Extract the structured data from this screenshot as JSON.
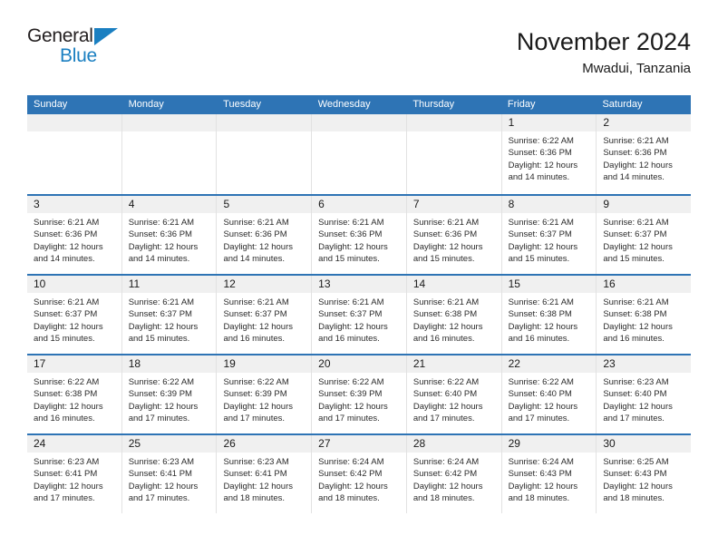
{
  "brand": {
    "name_top": "General",
    "name_bottom": "Blue",
    "accent_color": "#1a7fc1"
  },
  "header": {
    "title": "November 2024",
    "subtitle": "Mwadui, Tanzania",
    "header_bg_color": "#2e74b5",
    "number_strip_color": "#f0f0f0"
  },
  "weekdays": [
    "Sunday",
    "Monday",
    "Tuesday",
    "Wednesday",
    "Thursday",
    "Friday",
    "Saturday"
  ],
  "weeks": [
    [
      {
        "day": "",
        "empty": true
      },
      {
        "day": "",
        "empty": true
      },
      {
        "day": "",
        "empty": true
      },
      {
        "day": "",
        "empty": true
      },
      {
        "day": "",
        "empty": true
      },
      {
        "day": "1",
        "sunrise": "Sunrise: 6:22 AM",
        "sunset": "Sunset: 6:36 PM",
        "daylight1": "Daylight: 12 hours",
        "daylight2": "and 14 minutes."
      },
      {
        "day": "2",
        "sunrise": "Sunrise: 6:21 AM",
        "sunset": "Sunset: 6:36 PM",
        "daylight1": "Daylight: 12 hours",
        "daylight2": "and 14 minutes."
      }
    ],
    [
      {
        "day": "3",
        "sunrise": "Sunrise: 6:21 AM",
        "sunset": "Sunset: 6:36 PM",
        "daylight1": "Daylight: 12 hours",
        "daylight2": "and 14 minutes."
      },
      {
        "day": "4",
        "sunrise": "Sunrise: 6:21 AM",
        "sunset": "Sunset: 6:36 PM",
        "daylight1": "Daylight: 12 hours",
        "daylight2": "and 14 minutes."
      },
      {
        "day": "5",
        "sunrise": "Sunrise: 6:21 AM",
        "sunset": "Sunset: 6:36 PM",
        "daylight1": "Daylight: 12 hours",
        "daylight2": "and 14 minutes."
      },
      {
        "day": "6",
        "sunrise": "Sunrise: 6:21 AM",
        "sunset": "Sunset: 6:36 PM",
        "daylight1": "Daylight: 12 hours",
        "daylight2": "and 15 minutes."
      },
      {
        "day": "7",
        "sunrise": "Sunrise: 6:21 AM",
        "sunset": "Sunset: 6:36 PM",
        "daylight1": "Daylight: 12 hours",
        "daylight2": "and 15 minutes."
      },
      {
        "day": "8",
        "sunrise": "Sunrise: 6:21 AM",
        "sunset": "Sunset: 6:37 PM",
        "daylight1": "Daylight: 12 hours",
        "daylight2": "and 15 minutes."
      },
      {
        "day": "9",
        "sunrise": "Sunrise: 6:21 AM",
        "sunset": "Sunset: 6:37 PM",
        "daylight1": "Daylight: 12 hours",
        "daylight2": "and 15 minutes."
      }
    ],
    [
      {
        "day": "10",
        "sunrise": "Sunrise: 6:21 AM",
        "sunset": "Sunset: 6:37 PM",
        "daylight1": "Daylight: 12 hours",
        "daylight2": "and 15 minutes."
      },
      {
        "day": "11",
        "sunrise": "Sunrise: 6:21 AM",
        "sunset": "Sunset: 6:37 PM",
        "daylight1": "Daylight: 12 hours",
        "daylight2": "and 15 minutes."
      },
      {
        "day": "12",
        "sunrise": "Sunrise: 6:21 AM",
        "sunset": "Sunset: 6:37 PM",
        "daylight1": "Daylight: 12 hours",
        "daylight2": "and 16 minutes."
      },
      {
        "day": "13",
        "sunrise": "Sunrise: 6:21 AM",
        "sunset": "Sunset: 6:37 PM",
        "daylight1": "Daylight: 12 hours",
        "daylight2": "and 16 minutes."
      },
      {
        "day": "14",
        "sunrise": "Sunrise: 6:21 AM",
        "sunset": "Sunset: 6:38 PM",
        "daylight1": "Daylight: 12 hours",
        "daylight2": "and 16 minutes."
      },
      {
        "day": "15",
        "sunrise": "Sunrise: 6:21 AM",
        "sunset": "Sunset: 6:38 PM",
        "daylight1": "Daylight: 12 hours",
        "daylight2": "and 16 minutes."
      },
      {
        "day": "16",
        "sunrise": "Sunrise: 6:21 AM",
        "sunset": "Sunset: 6:38 PM",
        "daylight1": "Daylight: 12 hours",
        "daylight2": "and 16 minutes."
      }
    ],
    [
      {
        "day": "17",
        "sunrise": "Sunrise: 6:22 AM",
        "sunset": "Sunset: 6:38 PM",
        "daylight1": "Daylight: 12 hours",
        "daylight2": "and 16 minutes."
      },
      {
        "day": "18",
        "sunrise": "Sunrise: 6:22 AM",
        "sunset": "Sunset: 6:39 PM",
        "daylight1": "Daylight: 12 hours",
        "daylight2": "and 17 minutes."
      },
      {
        "day": "19",
        "sunrise": "Sunrise: 6:22 AM",
        "sunset": "Sunset: 6:39 PM",
        "daylight1": "Daylight: 12 hours",
        "daylight2": "and 17 minutes."
      },
      {
        "day": "20",
        "sunrise": "Sunrise: 6:22 AM",
        "sunset": "Sunset: 6:39 PM",
        "daylight1": "Daylight: 12 hours",
        "daylight2": "and 17 minutes."
      },
      {
        "day": "21",
        "sunrise": "Sunrise: 6:22 AM",
        "sunset": "Sunset: 6:40 PM",
        "daylight1": "Daylight: 12 hours",
        "daylight2": "and 17 minutes."
      },
      {
        "day": "22",
        "sunrise": "Sunrise: 6:22 AM",
        "sunset": "Sunset: 6:40 PM",
        "daylight1": "Daylight: 12 hours",
        "daylight2": "and 17 minutes."
      },
      {
        "day": "23",
        "sunrise": "Sunrise: 6:23 AM",
        "sunset": "Sunset: 6:40 PM",
        "daylight1": "Daylight: 12 hours",
        "daylight2": "and 17 minutes."
      }
    ],
    [
      {
        "day": "24",
        "sunrise": "Sunrise: 6:23 AM",
        "sunset": "Sunset: 6:41 PM",
        "daylight1": "Daylight: 12 hours",
        "daylight2": "and 17 minutes."
      },
      {
        "day": "25",
        "sunrise": "Sunrise: 6:23 AM",
        "sunset": "Sunset: 6:41 PM",
        "daylight1": "Daylight: 12 hours",
        "daylight2": "and 17 minutes."
      },
      {
        "day": "26",
        "sunrise": "Sunrise: 6:23 AM",
        "sunset": "Sunset: 6:41 PM",
        "daylight1": "Daylight: 12 hours",
        "daylight2": "and 18 minutes."
      },
      {
        "day": "27",
        "sunrise": "Sunrise: 6:24 AM",
        "sunset": "Sunset: 6:42 PM",
        "daylight1": "Daylight: 12 hours",
        "daylight2": "and 18 minutes."
      },
      {
        "day": "28",
        "sunrise": "Sunrise: 6:24 AM",
        "sunset": "Sunset: 6:42 PM",
        "daylight1": "Daylight: 12 hours",
        "daylight2": "and 18 minutes."
      },
      {
        "day": "29",
        "sunrise": "Sunrise: 6:24 AM",
        "sunset": "Sunset: 6:43 PM",
        "daylight1": "Daylight: 12 hours",
        "daylight2": "and 18 minutes."
      },
      {
        "day": "30",
        "sunrise": "Sunrise: 6:25 AM",
        "sunset": "Sunset: 6:43 PM",
        "daylight1": "Daylight: 12 hours",
        "daylight2": "and 18 minutes."
      }
    ]
  ]
}
